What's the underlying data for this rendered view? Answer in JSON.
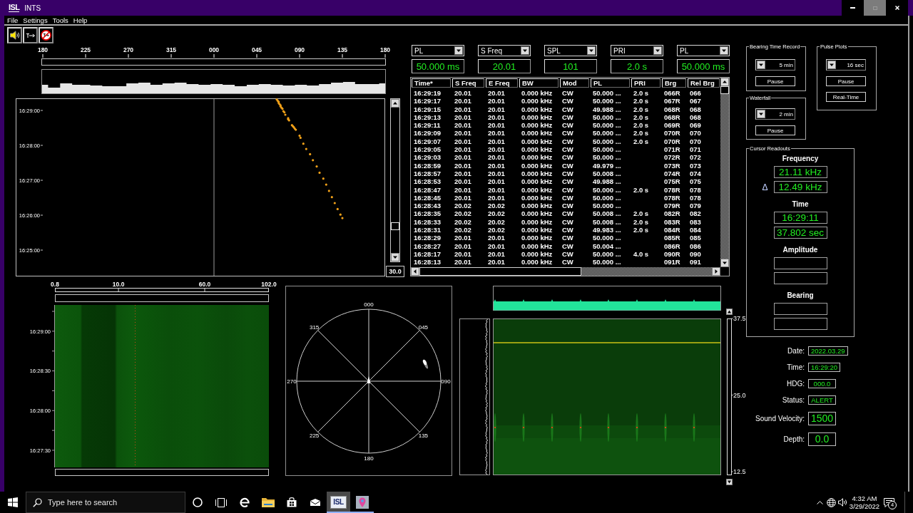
{
  "window": {
    "logo": "ISL",
    "title": "INTS",
    "controls": [
      {
        "kind": "minimize",
        "disabled": false
      },
      {
        "kind": "maximize",
        "disabled": true
      },
      {
        "kind": "close",
        "disabled": false
      }
    ]
  },
  "menu": [
    "File",
    "Settings",
    "Tools",
    "Help"
  ],
  "toolbar": [
    {
      "kind": "speaker"
    },
    {
      "kind": "transmit"
    },
    {
      "kind": "no-transmit"
    }
  ],
  "bearing_plot": {
    "bearing_ticks": [
      "180",
      "225",
      "270",
      "315",
      "000",
      "045",
      "090",
      "135",
      "180"
    ],
    "time_ticks": [
      "16:29:00",
      "16:28:00",
      "16:27:00",
      "16:26:00",
      "16:25:00"
    ],
    "range": "30.0"
  },
  "selectors": [
    {
      "field": "PL",
      "value": "50.000 ms"
    },
    {
      "field": "S Freq",
      "value": "20.01"
    },
    {
      "field": "SPL",
      "value": "101"
    },
    {
      "field": "PRI",
      "value": "2.0 s"
    },
    {
      "field": "PL",
      "value": "50.000 ms"
    }
  ],
  "table": {
    "columns": [
      "Time*",
      "S Freq",
      "E Freq",
      "BW",
      "Mod",
      "PL",
      "PRI",
      "Brg",
      "Rel Brg"
    ],
    "rows": [
      {
        "time": "16:29:19",
        "s_freq": "20.01",
        "e_freq": "20.01",
        "bw": "0.000 kHz",
        "mod": "CW",
        "pl": "50.000 ...",
        "pri": "2.0 s",
        "brg": "066R",
        "rel_brg": "066"
      },
      {
        "time": "16:29:17",
        "s_freq": "20.01",
        "e_freq": "20.01",
        "bw": "0.000 kHz",
        "mod": "CW",
        "pl": "50.000 ...",
        "pri": "2.0 s",
        "brg": "067R",
        "rel_brg": "067"
      },
      {
        "time": "16:29:15",
        "s_freq": "20.01",
        "e_freq": "20.01",
        "bw": "0.000 kHz",
        "mod": "CW",
        "pl": "49.988 ...",
        "pri": "2.0 s",
        "brg": "068R",
        "rel_brg": "068"
      },
      {
        "time": "16:29:13",
        "s_freq": "20.01",
        "e_freq": "20.01",
        "bw": "0.000 kHz",
        "mod": "CW",
        "pl": "50.000 ...",
        "pri": "2.0 s",
        "brg": "068R",
        "rel_brg": "068"
      },
      {
        "time": "16:29:11",
        "s_freq": "20.01",
        "e_freq": "20.01",
        "bw": "0.000 kHz",
        "mod": "CW",
        "pl": "50.000 ...",
        "pri": "2.0 s",
        "brg": "069R",
        "rel_brg": "069"
      },
      {
        "time": "16:29:09",
        "s_freq": "20.01",
        "e_freq": "20.01",
        "bw": "0.000 kHz",
        "mod": "CW",
        "pl": "50.000 ...",
        "pri": "2.0 s",
        "brg": "070R",
        "rel_brg": "070"
      },
      {
        "time": "16:29:07",
        "s_freq": "20.01",
        "e_freq": "20.01",
        "bw": "0.000 kHz",
        "mod": "CW",
        "pl": "50.000 ...",
        "pri": "2.0 s",
        "brg": "070R",
        "rel_brg": "070"
      },
      {
        "time": "16:29:05",
        "s_freq": "20.01",
        "e_freq": "20.01",
        "bw": "0.000 kHz",
        "mod": "CW",
        "pl": "50.000 ...",
        "brg": "071R",
        "rel_brg": "071"
      },
      {
        "time": "16:29:03",
        "s_freq": "20.01",
        "e_freq": "20.01",
        "bw": "0.000 kHz",
        "mod": "CW",
        "pl": "50.000 ...",
        "brg": "072R",
        "rel_brg": "072"
      },
      {
        "time": "16:28:59",
        "s_freq": "20.01",
        "e_freq": "20.01",
        "bw": "0.000 kHz",
        "mod": "CW",
        "pl": "49.979 ...",
        "brg": "073R",
        "rel_brg": "073"
      },
      {
        "time": "16:28:57",
        "s_freq": "20.01",
        "e_freq": "20.01",
        "bw": "0.000 kHz",
        "mod": "CW",
        "pl": "50.008 ...",
        "brg": "074R",
        "rel_brg": "074"
      },
      {
        "time": "16:28:53",
        "s_freq": "20.01",
        "e_freq": "20.01",
        "bw": "0.000 kHz",
        "mod": "CW",
        "pl": "49.988 ...",
        "brg": "075R",
        "rel_brg": "075"
      },
      {
        "time": "16:28:47",
        "s_freq": "20.01",
        "e_freq": "20.01",
        "bw": "0.000 kHz",
        "mod": "CW",
        "pl": "50.000 ...",
        "pri": "2.0 s",
        "brg": "078R",
        "rel_brg": "078"
      },
      {
        "time": "16:28:45",
        "s_freq": "20.01",
        "e_freq": "20.01",
        "bw": "0.000 kHz",
        "mod": "CW",
        "pl": "50.000 ...",
        "brg": "078R",
        "rel_brg": "078"
      },
      {
        "time": "16:28:43",
        "s_freq": "20.02",
        "e_freq": "20.02",
        "bw": "0.000 kHz",
        "mod": "CW",
        "pl": "50.000 ...",
        "brg": "079R",
        "rel_brg": "079"
      },
      {
        "time": "16:28:35",
        "s_freq": "20.02",
        "e_freq": "20.02",
        "bw": "0.000 kHz",
        "mod": "CW",
        "pl": "50.008 ...",
        "pri": "2.0 s",
        "brg": "082R",
        "rel_brg": "082"
      },
      {
        "time": "16:28:33",
        "s_freq": "20.02",
        "e_freq": "20.02",
        "bw": "0.000 kHz",
        "mod": "CW",
        "pl": "50.008 ...",
        "pri": "2.0 s",
        "brg": "083R",
        "rel_brg": "083"
      },
      {
        "time": "16:28:31",
        "s_freq": "20.02",
        "e_freq": "20.02",
        "bw": "0.000 kHz",
        "mod": "CW",
        "pl": "49.983 ...",
        "pri": "2.0 s",
        "brg": "084R",
        "rel_brg": "084"
      },
      {
        "time": "16:28:29",
        "s_freq": "20.01",
        "e_freq": "20.01",
        "bw": "0.000 kHz",
        "mod": "CW",
        "pl": "50.000 ...",
        "brg": "085R",
        "rel_brg": "085"
      },
      {
        "time": "16:28:27",
        "s_freq": "20.01",
        "e_freq": "20.01",
        "bw": "0.000 kHz",
        "mod": "CW",
        "pl": "50.004 ...",
        "brg": "086R",
        "rel_brg": "086"
      },
      {
        "time": "16:28:17",
        "s_freq": "20.01",
        "e_freq": "20.01",
        "bw": "0.000 kHz",
        "mod": "CW",
        "pl": "50.000 ...",
        "pri": "4.0 s",
        "brg": "090R",
        "rel_brg": "090"
      },
      {
        "time": "16:28:13",
        "s_freq": "20.01",
        "e_freq": "20.01",
        "bw": "0.000 kHz",
        "mod": "CW",
        "pl": "50.000 ...",
        "brg": "091R",
        "rel_brg": "091"
      }
    ]
  },
  "bearing_time_record": {
    "title": "Bearing Time Record",
    "span": "5 min",
    "buttons": [
      "Pause"
    ]
  },
  "pulse_plots": {
    "title": "Pulse Plots",
    "span": "16 sec",
    "buttons": [
      "Pause",
      "Real-Time"
    ]
  },
  "waterfall_settings": {
    "title": "Waterfall",
    "span": "2 min",
    "buttons": [
      "Pause"
    ]
  },
  "cursor_readouts": {
    "title": "Cursor Readouts",
    "sections": [
      {
        "label": "Frequency",
        "kind": "values",
        "fields": [
          {
            "value": "21.11 kHz"
          },
          {
            "value": "12.49 kHz",
            "prefix": "Δ"
          }
        ]
      },
      {
        "label": "Time",
        "kind": "values",
        "fields": [
          {
            "value": "16:29:11"
          },
          {
            "value": "37.802 sec"
          }
        ]
      },
      {
        "label": "Amplitude",
        "kind": "empty"
      },
      {
        "label": "Bearing",
        "kind": "empty"
      }
    ]
  },
  "status": [
    {
      "label": "Date:",
      "value": "2022.03.29",
      "kind": "display"
    },
    {
      "label": "Time:",
      "value": "16:29:20",
      "kind": "display"
    },
    {
      "label": "HDG:",
      "value": "000.0",
      "kind": "display"
    },
    {
      "label": "Status:",
      "value": "ALERT",
      "kind": "display"
    },
    {
      "label": "Sound Velocity:",
      "value": "1500",
      "kind": "input"
    },
    {
      "label": "Depth:",
      "value": "0.0",
      "kind": "input"
    }
  ],
  "waterfall": {
    "freq_ticks": [
      "0.8",
      "10.0",
      "60.0",
      "102.0"
    ],
    "time_ticks": [
      "16:29:00",
      "16:28:30",
      "16:28:00",
      "16:27:30"
    ]
  },
  "polar_plot": {
    "bearing_labels": [
      "000",
      "045",
      "090",
      "135",
      "180",
      "225",
      "270",
      "315"
    ]
  },
  "pulse_display": {
    "scale_labels": [
      "37.5",
      "25.0",
      "12.5"
    ]
  },
  "taskbar": {
    "search": {
      "placeholder": "Type here to search"
    },
    "buttons": [
      {
        "kind": "assistant"
      },
      {
        "kind": "task-view"
      }
    ],
    "apps": [
      {
        "kind": "browser",
        "selected": false,
        "running": false
      },
      {
        "kind": "folder",
        "selected": false,
        "running": false
      },
      {
        "kind": "store",
        "selected": false,
        "running": false
      },
      {
        "kind": "mail",
        "selected": false,
        "running": false
      },
      {
        "kind": "logo",
        "logo": "ISL",
        "selected": true,
        "running": true
      },
      {
        "kind": "map",
        "selected": false,
        "running": true
      }
    ],
    "tray": [
      {
        "kind": "chevron"
      },
      {
        "kind": "network"
      },
      {
        "kind": "volume"
      }
    ],
    "clock": {
      "time": "4:32 AM",
      "date": "3/29/2022"
    },
    "notifications": "4"
  }
}
